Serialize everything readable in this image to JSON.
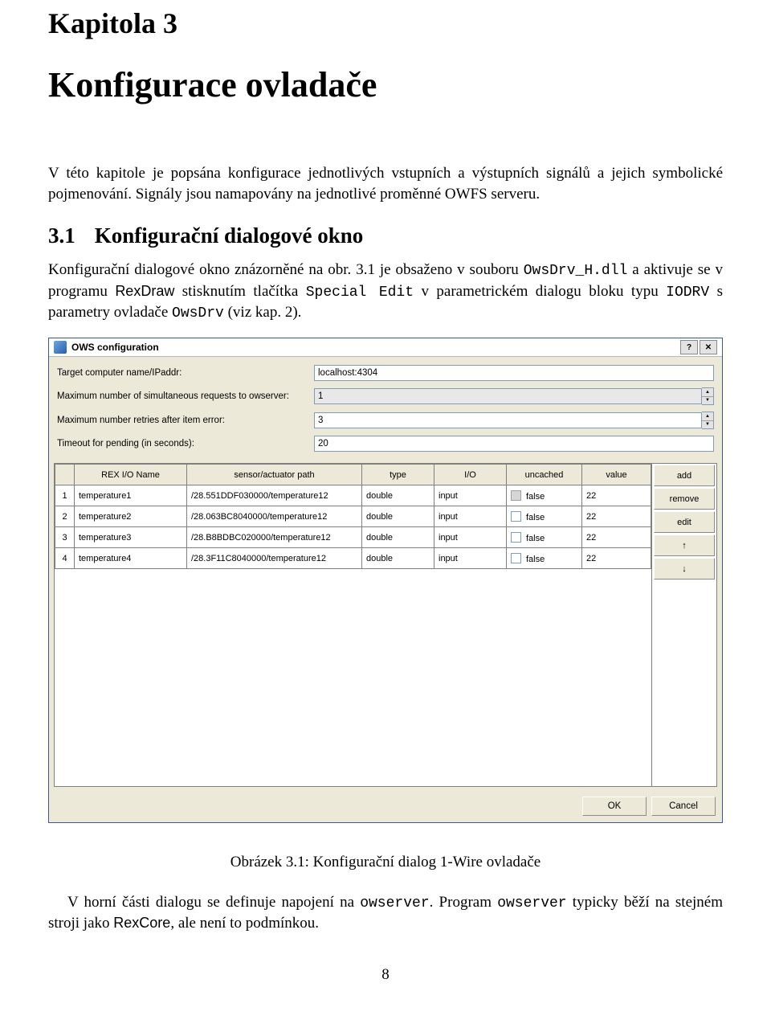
{
  "chapter": {
    "label": "Kapitola 3",
    "title": "Konfigurace ovladače"
  },
  "p1_a": "V této kapitole je popsána konfigurace jednotlivých vstupních a výstupních signálů a jejich symbolické pojmenování. Signály jsou namapovány na jednotlivé proměnné OWFS serveru.",
  "section": {
    "num": "3.1",
    "title": "Konfigurační dialogové okno"
  },
  "p2_pre": "Konfigurační dialogové okno znázorněné na obr. 3.1 je obsaženo v souboru ",
  "p2_file": "OwsDrv_H.dll",
  "p2_mid1": " a aktivuje se v programu ",
  "p2_rex": "RexDraw",
  "p2_mid2": " stisknutím tlačítka ",
  "p2_btn": "Special Edit",
  "p2_mid3": " v parametrickém dialogu bloku typu ",
  "p2_iodrv": "IODRV",
  "p2_mid4": " s parametry ovladače ",
  "p2_ows": "OwsDrv",
  "p2_end": " (viz kap. 2).",
  "dialog": {
    "title": "OWS configuration",
    "help": "?",
    "close": "✕",
    "fields": {
      "target_label": "Target computer name/IPaddr:",
      "target_value": "localhost:4304",
      "maxreq_label": "Maximum number of simultaneous requests to owserver:",
      "maxreq_value": "1",
      "retries_label": "Maximum number retries after item error:",
      "retries_value": "3",
      "timeout_label": "Timeout for pending (in seconds):",
      "timeout_value": "20"
    },
    "headers": {
      "name": "REX I/O Name",
      "path": "sensor/actuator path",
      "type": "type",
      "io": "I/O",
      "uncached": "uncached",
      "value": "value"
    },
    "rows": [
      {
        "idx": "1",
        "name": "temperature1",
        "path": "/28.551DDF030000/temperature12",
        "type": "double",
        "io": "input",
        "unc": "false",
        "val": "22"
      },
      {
        "idx": "2",
        "name": "temperature2",
        "path": "/28.063BC8040000/temperature12",
        "type": "double",
        "io": "input",
        "unc": "false",
        "val": "22"
      },
      {
        "idx": "3",
        "name": "temperature3",
        "path": "/28.B8BDBC020000/temperature12",
        "type": "double",
        "io": "input",
        "unc": "false",
        "val": "22"
      },
      {
        "idx": "4",
        "name": "temperature4",
        "path": "/28.3F11C8040000/temperature12",
        "type": "double",
        "io": "input",
        "unc": "false",
        "val": "22"
      }
    ],
    "side": {
      "add": "add",
      "remove": "remove",
      "edit": "edit",
      "up": "↑",
      "down": "↓"
    },
    "ok": "OK",
    "cancel": "Cancel"
  },
  "figcap": "Obrázek 3.1: Konfigurační dialog 1-Wire ovladače",
  "p3_a": "V horní části dialogu se definuje napojení na ",
  "p3_ows": "owserver",
  "p3_b": ". Program ",
  "p3_ows2": "owserver",
  "p3_c": " typicky běží na stejném stroji jako ",
  "p3_rex": "RexCore",
  "p3_d": ", ale není to podmínkou.",
  "pagenum": "8"
}
